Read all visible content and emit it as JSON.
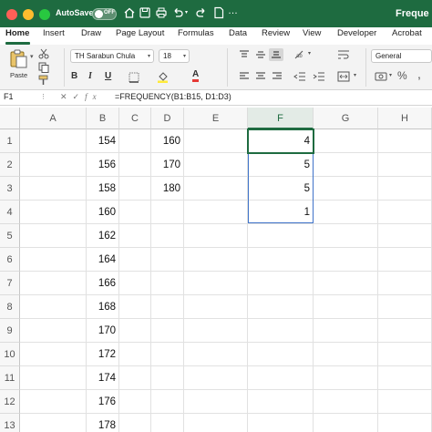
{
  "titlebar": {
    "autosave_label": "AutoSave",
    "toggle_label": "OFF",
    "doc_title": "Freque"
  },
  "tabs": [
    "Home",
    "Insert",
    "Draw",
    "Page Layout",
    "Formulas",
    "Data",
    "Review",
    "View",
    "Developer",
    "Acrobat"
  ],
  "ribbon": {
    "paste_label": "Paste",
    "font_name": "TH Sarabun Chula",
    "font_size": "18",
    "number_format": "General",
    "percent_symbol": "%",
    "comma_symbol": ","
  },
  "formula_bar": {
    "name_box": "F1",
    "formula": "=FREQUENCY(B1:B15, D1:D3)",
    "icons": [
      "x-icon",
      "check-icon",
      "fx-icon"
    ]
  },
  "grid": {
    "columns": [
      "A",
      "B",
      "C",
      "D",
      "E",
      "F",
      "G",
      "H"
    ],
    "selected_column": "F",
    "rows": [
      {
        "n": "1",
        "A": "",
        "B": "154",
        "C": "",
        "D": "160",
        "E": "",
        "F": "4",
        "G": "",
        "H": ""
      },
      {
        "n": "2",
        "A": "",
        "B": "156",
        "C": "",
        "D": "170",
        "E": "",
        "F": "5",
        "G": "",
        "H": ""
      },
      {
        "n": "3",
        "A": "",
        "B": "158",
        "C": "",
        "D": "180",
        "E": "",
        "F": "5",
        "G": "",
        "H": ""
      },
      {
        "n": "4",
        "A": "",
        "B": "160",
        "C": "",
        "D": "",
        "E": "",
        "F": "1",
        "G": "",
        "H": ""
      },
      {
        "n": "5",
        "A": "",
        "B": "162",
        "C": "",
        "D": "",
        "E": "",
        "F": "",
        "G": "",
        "H": ""
      },
      {
        "n": "6",
        "A": "",
        "B": "164",
        "C": "",
        "D": "",
        "E": "",
        "F": "",
        "G": "",
        "H": ""
      },
      {
        "n": "7",
        "A": "",
        "B": "166",
        "C": "",
        "D": "",
        "E": "",
        "F": "",
        "G": "",
        "H": ""
      },
      {
        "n": "8",
        "A": "",
        "B": "168",
        "C": "",
        "D": "",
        "E": "",
        "F": "",
        "G": "",
        "H": ""
      },
      {
        "n": "9",
        "A": "",
        "B": "170",
        "C": "",
        "D": "",
        "E": "",
        "F": "",
        "G": "",
        "H": ""
      },
      {
        "n": "10",
        "A": "",
        "B": "172",
        "C": "",
        "D": "",
        "E": "",
        "F": "",
        "G": "",
        "H": ""
      },
      {
        "n": "11",
        "A": "",
        "B": "174",
        "C": "",
        "D": "",
        "E": "",
        "F": "",
        "G": "",
        "H": ""
      },
      {
        "n": "12",
        "A": "",
        "B": "176",
        "C": "",
        "D": "",
        "E": "",
        "F": "",
        "G": "",
        "H": ""
      },
      {
        "n": "13",
        "A": "",
        "B": "178",
        "C": "",
        "D": "",
        "E": "",
        "F": "",
        "G": "",
        "H": ""
      }
    ]
  },
  "colors": {
    "brand_green": "#1e6b40",
    "selection_blue": "#3f73c9"
  }
}
